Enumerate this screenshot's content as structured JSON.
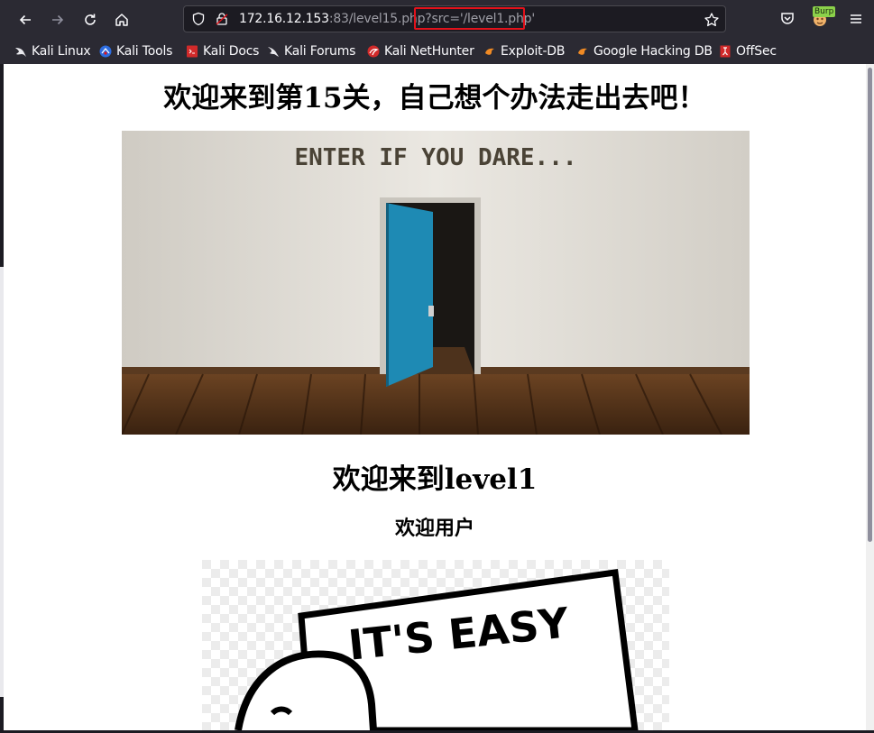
{
  "browser": {
    "url_host": "172.16.12.153",
    "url_rest": ":83/level15.php",
    "url_query": "?src='/level1.php'",
    "extension_badge": "Burp",
    "bookmarks": [
      {
        "label": "Kali Linux",
        "icon": "kali-dragon-icon"
      },
      {
        "label": "Kali Tools",
        "icon": "kali-tools-icon"
      },
      {
        "label": "Kali Docs",
        "icon": "kali-docs-icon"
      },
      {
        "label": "Kali Forums",
        "icon": "kali-forums-icon"
      },
      {
        "label": "Kali NetHunter",
        "icon": "nethunter-icon"
      },
      {
        "label": "Exploit-DB",
        "icon": "exploit-db-icon"
      },
      {
        "label": "Google Hacking DB",
        "icon": "ghdb-icon"
      },
      {
        "label": "OffSec",
        "icon": "offsec-icon"
      }
    ]
  },
  "page": {
    "title": "欢迎来到第15关，自己想个办法走出去吧！",
    "door_sign": "ENTER IF YOU DARE...",
    "level_title": "欢迎来到level1",
    "welcome_user": "欢迎用户",
    "easy_sign": "IT'S EASY"
  },
  "colors": {
    "highlight_box": "#e2121b",
    "toolbar_bg": "#2b2a33",
    "door_blue": "#1e8ab4"
  }
}
